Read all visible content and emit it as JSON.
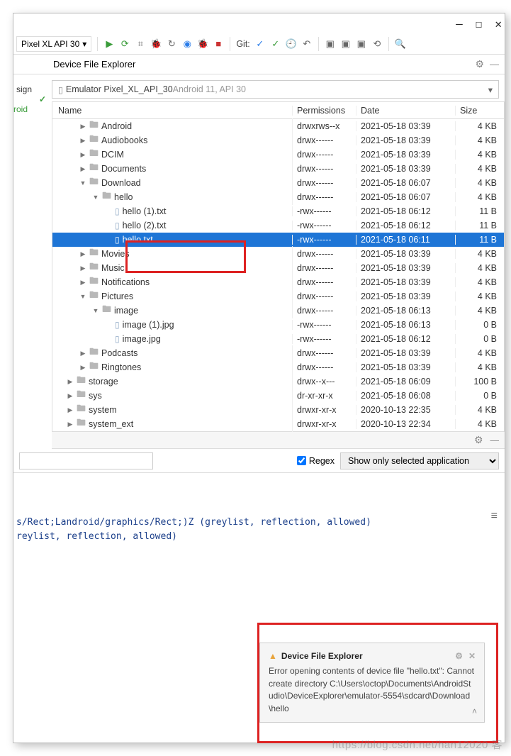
{
  "titlebar": {
    "min": "—",
    "max": "☐",
    "close": "✕"
  },
  "runconfig": {
    "label": "Pixel XL API 30",
    "dd": "▾"
  },
  "vcs_label": "Git:",
  "panel": {
    "title": "Device File Explorer",
    "gear": "⚙",
    "hide": "—"
  },
  "left": {
    "sign": "sign",
    "chk": "✓",
    "roid": "roid"
  },
  "device": {
    "icon": "▯",
    "name": "Emulator Pixel_XL_API_30",
    "sub": " Android 11, API 30",
    "arr": "▾"
  },
  "cols": {
    "name": "Name",
    "perm": "Permissions",
    "date": "Date",
    "size": "Size"
  },
  "tri": {
    "right": "▶",
    "down": "▼"
  },
  "icons": {
    "folder": "🖿",
    "file": "▯"
  },
  "rows": [
    {
      "ind": 1,
      "exp": "r",
      "ico": "folder",
      "name": "Android",
      "perm": "drwxrws--x",
      "date": "2021-05-18 03:39",
      "size": "4 KB",
      "sel": false
    },
    {
      "ind": 1,
      "exp": "r",
      "ico": "folder",
      "name": "Audiobooks",
      "perm": "drwx------",
      "date": "2021-05-18 03:39",
      "size": "4 KB",
      "sel": false
    },
    {
      "ind": 1,
      "exp": "r",
      "ico": "folder",
      "name": "DCIM",
      "perm": "drwx------",
      "date": "2021-05-18 03:39",
      "size": "4 KB",
      "sel": false
    },
    {
      "ind": 1,
      "exp": "r",
      "ico": "folder",
      "name": "Documents",
      "perm": "drwx------",
      "date": "2021-05-18 03:39",
      "size": "4 KB",
      "sel": false
    },
    {
      "ind": 1,
      "exp": "d",
      "ico": "folder",
      "name": "Download",
      "perm": "drwx------",
      "date": "2021-05-18 06:07",
      "size": "4 KB",
      "sel": false
    },
    {
      "ind": 2,
      "exp": "d",
      "ico": "folder",
      "name": "hello",
      "perm": "drwx------",
      "date": "2021-05-18 06:07",
      "size": "4 KB",
      "sel": false
    },
    {
      "ind": 3,
      "exp": "b",
      "ico": "file",
      "name": "hello (1).txt",
      "perm": "-rwx------",
      "date": "2021-05-18 06:12",
      "size": "11 B",
      "sel": false
    },
    {
      "ind": 3,
      "exp": "b",
      "ico": "file",
      "name": "hello (2).txt",
      "perm": "-rwx------",
      "date": "2021-05-18 06:12",
      "size": "11 B",
      "sel": false
    },
    {
      "ind": 3,
      "exp": "b",
      "ico": "file",
      "name": "hello.txt",
      "perm": "-rwx------",
      "date": "2021-05-18 06:11",
      "size": "11 B",
      "sel": true
    },
    {
      "ind": 1,
      "exp": "r",
      "ico": "folder",
      "name": "Movies",
      "perm": "drwx------",
      "date": "2021-05-18 03:39",
      "size": "4 KB",
      "sel": false
    },
    {
      "ind": 1,
      "exp": "r",
      "ico": "folder",
      "name": "Music",
      "perm": "drwx------",
      "date": "2021-05-18 03:39",
      "size": "4 KB",
      "sel": false
    },
    {
      "ind": 1,
      "exp": "r",
      "ico": "folder",
      "name": "Notifications",
      "perm": "drwx------",
      "date": "2021-05-18 03:39",
      "size": "4 KB",
      "sel": false
    },
    {
      "ind": 1,
      "exp": "d",
      "ico": "folder",
      "name": "Pictures",
      "perm": "drwx------",
      "date": "2021-05-18 03:39",
      "size": "4 KB",
      "sel": false
    },
    {
      "ind": 2,
      "exp": "d",
      "ico": "folder",
      "name": "image",
      "perm": "drwx------",
      "date": "2021-05-18 06:13",
      "size": "4 KB",
      "sel": false
    },
    {
      "ind": 3,
      "exp": "b",
      "ico": "file",
      "name": "image (1).jpg",
      "perm": "-rwx------",
      "date": "2021-05-18 06:13",
      "size": "0 B",
      "sel": false
    },
    {
      "ind": 3,
      "exp": "b",
      "ico": "file",
      "name": "image.jpg",
      "perm": "-rwx------",
      "date": "2021-05-18 06:12",
      "size": "0 B",
      "sel": false
    },
    {
      "ind": 1,
      "exp": "r",
      "ico": "folder",
      "name": "Podcasts",
      "perm": "drwx------",
      "date": "2021-05-18 03:39",
      "size": "4 KB",
      "sel": false
    },
    {
      "ind": 1,
      "exp": "r",
      "ico": "folder",
      "name": "Ringtones",
      "perm": "drwx------",
      "date": "2021-05-18 03:39",
      "size": "4 KB",
      "sel": false
    },
    {
      "ind": 0,
      "exp": "r",
      "ico": "folder",
      "name": "storage",
      "perm": "drwx--x---",
      "date": "2021-05-18 06:09",
      "size": "100 B",
      "sel": false
    },
    {
      "ind": 0,
      "exp": "r",
      "ico": "folder",
      "name": "sys",
      "perm": "dr-xr-xr-x",
      "date": "2021-05-18 06:08",
      "size": "0 B",
      "sel": false
    },
    {
      "ind": 0,
      "exp": "r",
      "ico": "folder",
      "name": "system",
      "perm": "drwxr-xr-x",
      "date": "2020-10-13 22:35",
      "size": "4 KB",
      "sel": false
    },
    {
      "ind": 0,
      "exp": "r",
      "ico": "folder",
      "name": "system_ext",
      "perm": "drwxr-xr-x",
      "date": "2020-10-13 22:34",
      "size": "4 KB",
      "sel": false
    }
  ],
  "filter": {
    "regex": "Regex",
    "select_label": "Show only selected application"
  },
  "log": {
    "l1": "s/Rect;Landroid/graphics/Rect;)Z (greylist, reflection, allowed)",
    "l2": "reylist, reflection, allowed)"
  },
  "notif": {
    "title": "Device File Explorer",
    "body": "Error opening contents of device file \"hello.txt\": Cannot create directory C:\\Users\\octop\\Documents\\AndroidStudio\\DeviceExplorer\\emulator-5554\\sdcard\\Download\\hello",
    "warn": "▲",
    "gear": "⚙",
    "x": "✕",
    "caret": "˄"
  },
  "watermark": "https://blog.csdn.net/han12020   客"
}
